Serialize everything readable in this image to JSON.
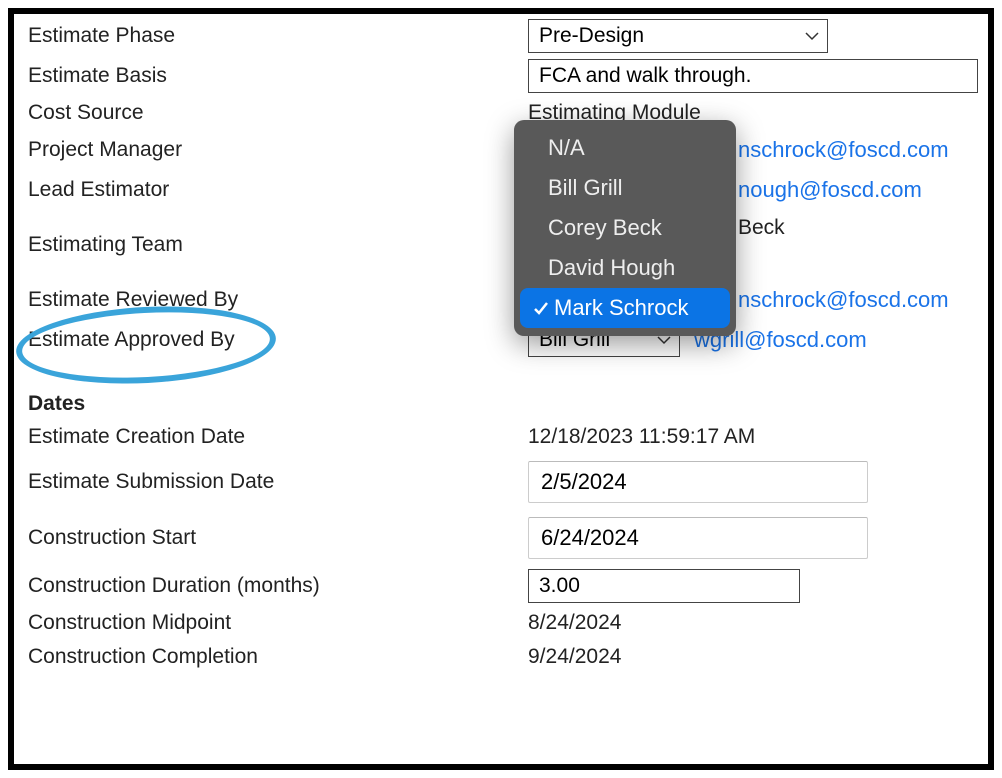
{
  "labels": {
    "estimate_phase": "Estimate Phase",
    "estimate_basis": "Estimate Basis",
    "cost_source": "Cost Source",
    "project_manager": "Project Manager",
    "lead_estimator": "Lead Estimator",
    "estimating_team": "Estimating Team",
    "estimate_reviewed_by": "Estimate Reviewed By",
    "estimate_approved_by": "Estimate Approved By",
    "dates_heading": "Dates",
    "estimate_creation_date": "Estimate Creation Date",
    "estimate_submission_date": "Estimate Submission Date",
    "construction_start": "Construction Start",
    "construction_duration": "Construction Duration (months)",
    "construction_midpoint": "Construction Midpoint",
    "construction_completion": "Construction Completion"
  },
  "values": {
    "estimate_phase": "Pre-Design",
    "estimate_basis": "FCA and walk through.",
    "cost_source": "Estimating Module",
    "project_manager_email_partial": "nschrock@foscd.com",
    "lead_estimator_email_partial": "nough@foscd.com",
    "estimating_team_partial": "Beck",
    "reviewed_by_email_partial": "nschrock@foscd.com",
    "approved_by_name": "Bill Grill",
    "approved_by_email": "wgrill@foscd.com",
    "creation_date": "12/18/2023 11:59:17 AM",
    "submission_date": "2/5/2024",
    "construction_start": "6/24/2024",
    "construction_duration": "3.00",
    "construction_midpoint": "8/24/2024",
    "construction_completion": "9/24/2024"
  },
  "reviewed_dropdown": {
    "options": [
      "N/A",
      "Bill Grill",
      "Corey Beck",
      "David Hough",
      "Mark Schrock"
    ],
    "selected_index": 4
  }
}
